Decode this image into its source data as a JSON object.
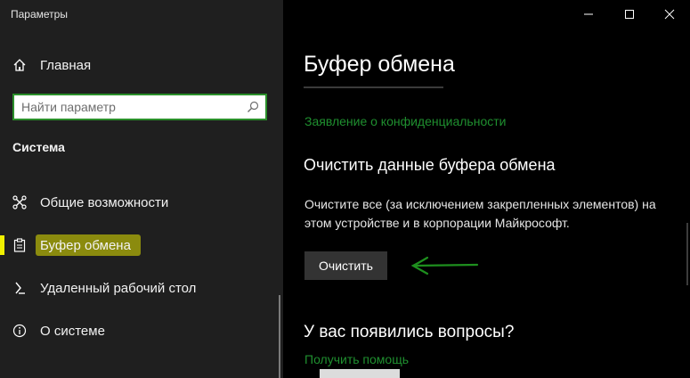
{
  "window": {
    "title": "Параметры"
  },
  "sidebar": {
    "home_label": "Главная",
    "search_placeholder": "Найти параметр",
    "section_title": "Система",
    "items": [
      {
        "label": "Общие возможности",
        "icon": "share-icon"
      },
      {
        "label": "Буфер обмена",
        "icon": "clipboard-icon",
        "active": true
      },
      {
        "label": "Удаленный рабочий стол",
        "icon": "remote-desktop-icon"
      },
      {
        "label": "О системе",
        "icon": "info-icon"
      }
    ]
  },
  "content": {
    "title": "Буфер обмена",
    "privacy_link": "Заявление о конфиденциальности",
    "clear_heading": "Очистить данные буфера обмена",
    "clear_description": "Очистите все (за исключением закрепленных элементов) на этом устройстве и в корпорации Майкрософт.",
    "clear_button": "Очистить",
    "questions_heading": "У вас появились вопросы?",
    "help_link": "Получить помощь"
  },
  "colors": {
    "accent_green": "#1f8f2f",
    "highlight_yellow": "#e4e400",
    "sidebar_bg": "#1f1f1f",
    "content_bg": "#000000"
  }
}
